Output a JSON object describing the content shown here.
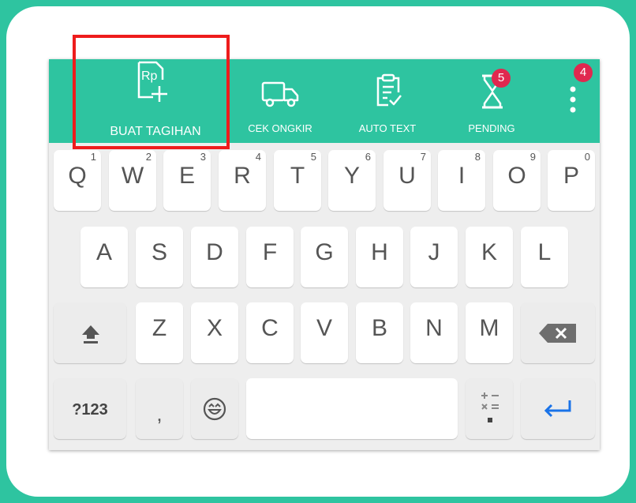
{
  "toolbar": {
    "items": [
      {
        "label": "BUAT TAGIHAN",
        "icon": "invoice-add-icon"
      },
      {
        "label": "CEK ONGKIR",
        "icon": "truck-icon"
      },
      {
        "label": "AUTO TEXT",
        "icon": "clipboard-check-icon"
      },
      {
        "label": "PENDING",
        "icon": "hourglass-icon",
        "badge": "5"
      }
    ],
    "more": {
      "icon": "more-vertical-icon",
      "badge": "4"
    },
    "icon_text": "Rp"
  },
  "keyboard": {
    "row1": [
      {
        "label": "Q",
        "hint": "1"
      },
      {
        "label": "W",
        "hint": "2"
      },
      {
        "label": "E",
        "hint": "3"
      },
      {
        "label": "R",
        "hint": "4"
      },
      {
        "label": "T",
        "hint": "5"
      },
      {
        "label": "Y",
        "hint": "6"
      },
      {
        "label": "U",
        "hint": "7"
      },
      {
        "label": "I",
        "hint": "8"
      },
      {
        "label": "O",
        "hint": "9"
      },
      {
        "label": "P",
        "hint": "0"
      }
    ],
    "row2": [
      "A",
      "S",
      "D",
      "F",
      "G",
      "H",
      "J",
      "K",
      "L"
    ],
    "row3": [
      "Z",
      "X",
      "C",
      "V",
      "B",
      "N",
      "M"
    ],
    "symbols_label": "?123",
    "comma_label": ",",
    "shift_icon": "shift-icon",
    "backspace_icon": "backspace-icon",
    "emoji_icon": "emoji-icon",
    "math_icon": "math-symbols-icon",
    "enter_icon": "enter-icon"
  },
  "colors": {
    "brand": "#2ec4a0",
    "badge": "#e0284f",
    "highlight": "#ee1c1c",
    "enter": "#1a73e8"
  }
}
